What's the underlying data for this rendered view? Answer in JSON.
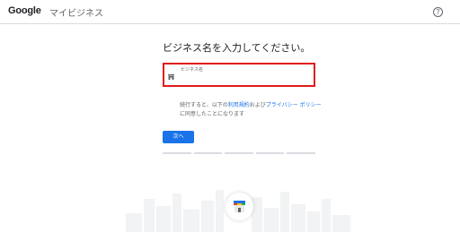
{
  "header": {
    "logo_text": "Google",
    "product_name": "マイビジネス",
    "help_icon": "help-circle-icon",
    "help_glyph": "?"
  },
  "main": {
    "heading": "ビジネス名を入力してください。",
    "business_name_field": {
      "label": "ビジネス名",
      "value": "",
      "icon": "storefront-icon"
    },
    "terms": {
      "prefix": "続行すると、以下の",
      "terms_link": "利用規約",
      "middle": "および",
      "privacy_link": "プライバシー ポリシー",
      "suffix": "に同意したことになります"
    },
    "next_button": "次へ",
    "progress_steps": 5
  },
  "colors": {
    "accent": "#1a73e8",
    "highlight_border": "#e21b1b",
    "divider": "#dadce0"
  }
}
